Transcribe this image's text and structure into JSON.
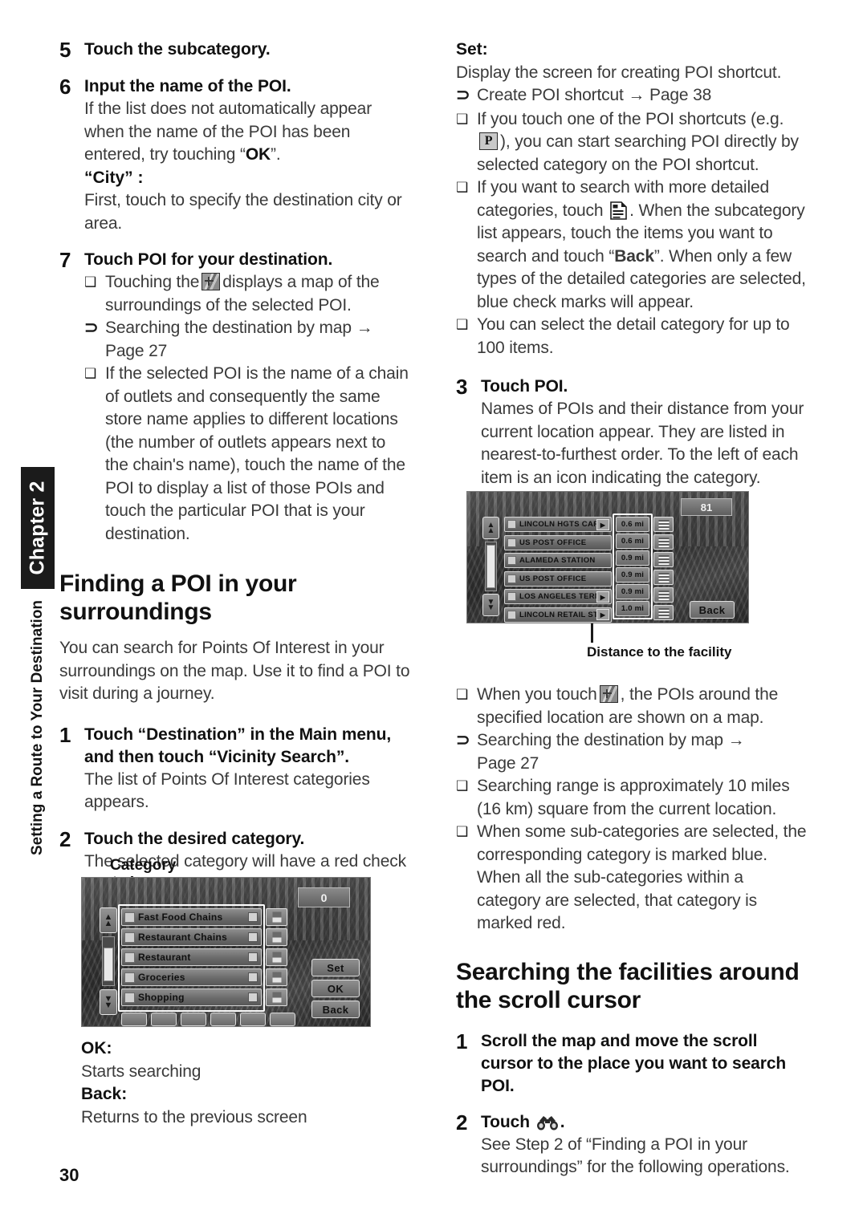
{
  "sidebar": {
    "chapter_tab": "Chapter 2",
    "section_caption": "Setting a Route to Your Destination"
  },
  "page_number": "30",
  "left_column": {
    "step5": {
      "num": "5",
      "title": "Touch the subcategory."
    },
    "step6": {
      "num": "6",
      "title": "Input the name of the POI.",
      "body": "If the list does not automatically appear when the name of the POI has been entered, try touching “OK”.",
      "body_pre": "If the list does not automatically appear when the name of the POI has been entered, try touching “",
      "body_bold": "OK",
      "body_post": "”.",
      "defterm": "“City” :",
      "def_body": "First, touch to specify the destination city or area."
    },
    "step7": {
      "num": "7",
      "title": "Touch POI for your destination.",
      "bullet1_pre": "Touching the",
      "bullet1_post": "displays a map of the surroundings of the selected POI.",
      "bullet2": "Searching the destination by map",
      "bullet2_page": "Page 27",
      "bullet3": "If the selected POI is the name of a chain of outlets and consequently the same store name applies to different locations (the number of outlets appears next to the chain's name), touch the name of the POI to display a list of those POIs and touch the particular POI that is your destination."
    },
    "heading": "Finding a POI in your surroundings",
    "intro": "You can search for Points Of Interest in your surroundings on the map. Use it to find a POI to visit during a journey.",
    "step1": {
      "num": "1",
      "title": "Touch “Destination” in the Main menu, and then touch “Vicinity Search”.",
      "body": "The list of Points Of Interest categories appears."
    },
    "step2": {
      "num": "2",
      "title": "Touch the desired category.",
      "body": "The selected category will have a red check mark."
    },
    "figure_label": "Category",
    "ok_term": "OK:",
    "ok_body": "Starts searching",
    "back_term": "Back:",
    "back_body": "Returns to the previous screen"
  },
  "right_column": {
    "set_term": "Set:",
    "set_body": "Display the screen for creating POI shortcut.",
    "ref1": "Create POI shortcut",
    "ref1_page": "Page 38",
    "bullet_shortcut_pre": "If you touch one of the POI shortcuts (e.g.",
    "bullet_shortcut_post": "), you can start searching POI directly by selected category on the POI shortcut.",
    "bullet_detail_pre": "If you want to search with more detailed categories, touch",
    "bullet_detail_mid": ". When the subcategory list appears, touch the items you want to search and touch “",
    "bullet_detail_bold": "Back",
    "bullet_detail_post": "”. When only a few types of the detailed categories are selected, blue check marks will appear.",
    "bullet_limit": "You can select the detail category for up to 100 items.",
    "step3": {
      "num": "3",
      "title": "Touch POI.",
      "body": "Names of POIs and their distance from your current location appear. They are listed in nearest-to-furthest order. To the left of each item is an icon indicating the category."
    },
    "figure_caption": "Distance to the facility",
    "bullet_touchmap_pre": "When you touch",
    "bullet_touchmap_post": ", the POIs around the specified location are shown on a map.",
    "ref2": "Searching the destination by map",
    "ref2_page": "Page 27",
    "bullet_range": "Searching range is approximately 10 miles (16 km) square from the current location.",
    "bullet_marks": "When some sub-categories are selected, the corresponding category is marked blue. When all the sub-categories within a category are selected, that category is marked red.",
    "heading2": "Searching the facilities around the scroll cursor",
    "step1b": {
      "num": "1",
      "title": "Scroll the map and move the scroll cursor to the place you want to search POI."
    },
    "step2b": {
      "num": "2",
      "title_pre": "Touch",
      "title_post": ".",
      "body": "See Step 2 of “Finding a POI in your surroundings” for the following operations."
    }
  },
  "category_screen": {
    "counter": "0",
    "rows": [
      {
        "label": "Fast Food Chains",
        "icon": "fast-food-icon"
      },
      {
        "label": "Restaurant Chains",
        "icon": "restaurant-chain-icon"
      },
      {
        "label": "Restaurant",
        "icon": "restaurant-icon"
      },
      {
        "label": "Groceries",
        "icon": "groceries-icon"
      },
      {
        "label": "Shopping",
        "icon": "shopping-icon"
      }
    ],
    "buttons": {
      "set": "Set",
      "ok": "OK",
      "back": "Back"
    },
    "scroll_up": "▲",
    "scroll_down": "▼"
  },
  "poi_screen": {
    "counter": "81",
    "rows": [
      {
        "label": "LINCOLN HGTS CARRIE",
        "more": "▶",
        "distance": "0.6  mi"
      },
      {
        "label": "US POST OFFICE",
        "more": "",
        "distance": "0.6  mi"
      },
      {
        "label": "ALAMEDA STATION",
        "more": "",
        "distance": "0.9  mi"
      },
      {
        "label": "US POST OFFICE",
        "more": "",
        "distance": "0.9  mi"
      },
      {
        "label": "LOS ANGELES TERMIN",
        "more": "▶",
        "distance": "0.9  mi"
      },
      {
        "label": "LINCOLN RETAIL STOR",
        "more": "▶",
        "distance": "1.0  mi"
      }
    ],
    "back_button": "Back",
    "scroll_up": "▲",
    "scroll_down": "▼"
  },
  "colors": {
    "text": "#3a3a3a",
    "heading": "#111111",
    "tab_bg": "#1b1b1b",
    "tab_fg": "#ffffff"
  }
}
